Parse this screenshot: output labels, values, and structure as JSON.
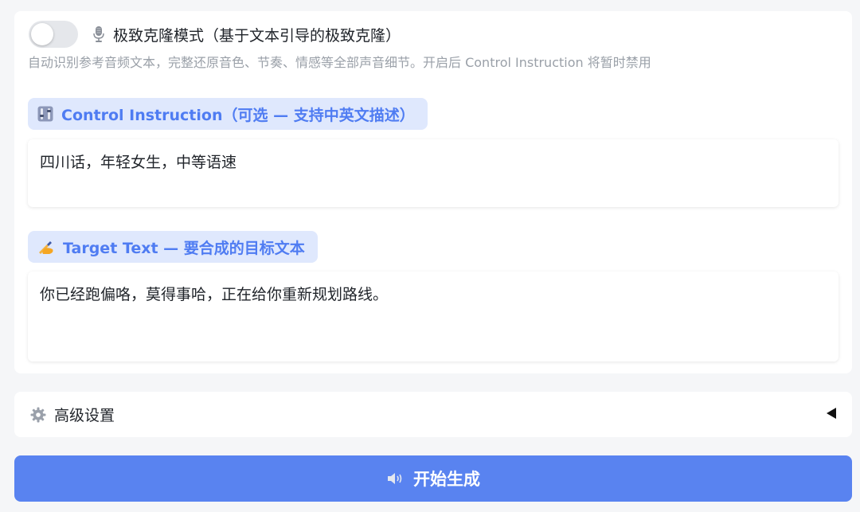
{
  "clone_mode": {
    "enabled": false,
    "icon": "microphone-icon",
    "label": "极致克隆模式（基于文本引导的极致克隆）",
    "help": "自动识别参考音频文本，完整还原音色、节奏、情感等全部声音细节。开启后 Control Instruction 将暂时禁用"
  },
  "control_instruction": {
    "icon": "control-knobs-icon",
    "label": "Control Instruction（可选 — 支持中英文描述）",
    "value": "四川话，年轻女生，中等语速"
  },
  "target_text": {
    "icon": "writing-hand-icon",
    "label": "Target Text — 要合成的目标文本",
    "value": "你已经跑偏咯，莫得事哈，正在给你重新规划路线。"
  },
  "advanced": {
    "icon": "gear-icon",
    "label": "高级设置",
    "expanded": false
  },
  "generate_button": {
    "icon": "speaker-icon",
    "label": "开始生成"
  },
  "colors": {
    "accent": "#5983f0",
    "chip_bg": "#dfe8fd",
    "chip_text": "#4f7cf2",
    "page_bg": "#f5f6f8"
  }
}
